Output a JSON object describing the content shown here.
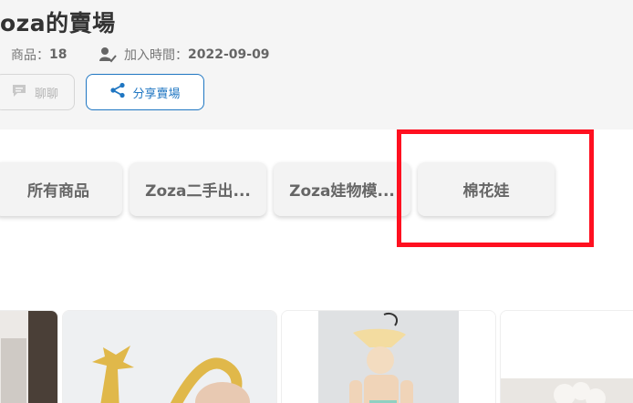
{
  "store": {
    "title": "oza的賣場",
    "products_label": "商品：",
    "products_count": "18",
    "joined_label": "加入時間：",
    "joined_date": "2022-09-09"
  },
  "buttons": {
    "chat_label": "聊聊",
    "share_label": "分享賣場"
  },
  "tabs": [
    {
      "label": "所有商品"
    },
    {
      "label": "Zoza二手出..."
    },
    {
      "label": "Zoza娃物模..."
    },
    {
      "label": "棉花娃"
    }
  ],
  "colors": {
    "accent": "#1f76c2",
    "highlight": "#ff1020",
    "header_bg": "#f5f5f5"
  },
  "icons": {
    "products": "shop-icon",
    "joined": "user-check-icon",
    "chat": "chat-bubble-icon",
    "share": "share-icon"
  }
}
